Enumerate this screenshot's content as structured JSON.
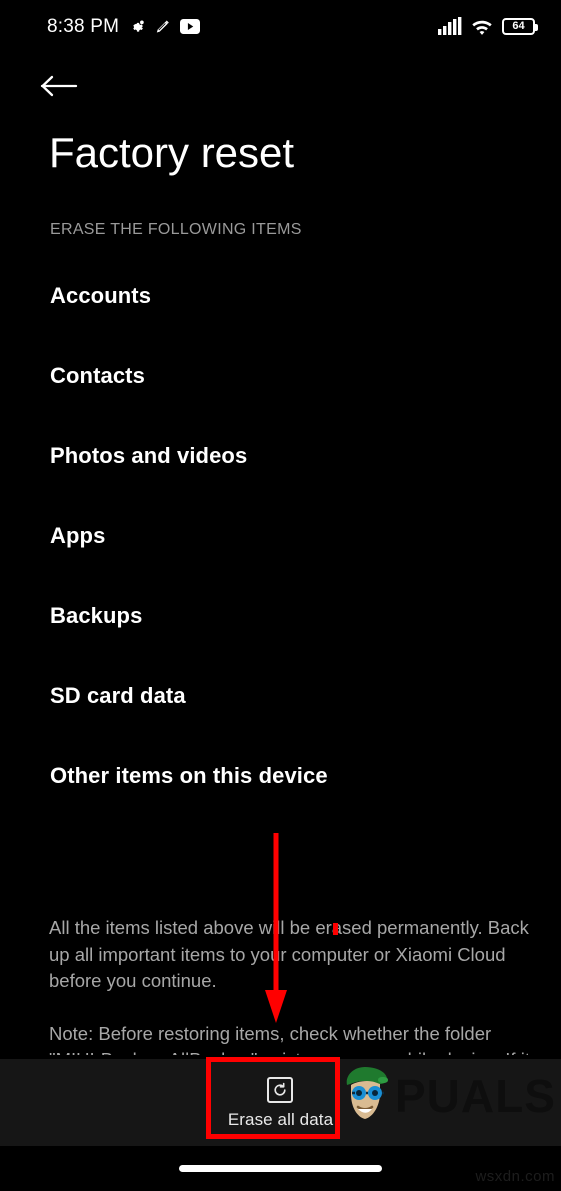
{
  "status_bar": {
    "time": "8:38 PM",
    "left_icons": [
      "gear-icon",
      "pen-icon",
      "youtube-icon"
    ],
    "right_icons": [
      "signal-icon",
      "wifi-icon"
    ],
    "battery_level": "64"
  },
  "header": {
    "back_icon": "back-arrow-icon",
    "title": "Factory reset"
  },
  "section": {
    "label": "ERASE THE FOLLOWING ITEMS"
  },
  "items": [
    {
      "label": "Accounts"
    },
    {
      "label": "Contacts"
    },
    {
      "label": "Photos and videos"
    },
    {
      "label": "Apps"
    },
    {
      "label": "Backups"
    },
    {
      "label": "SD card data"
    },
    {
      "label": "Other items on this device"
    }
  ],
  "description": {
    "paragraph1": "All the items listed above will be erased permanently. Back up all important items to your computer or Xiaomi Cloud before you continue.",
    "paragraph2": "Note: Before restoring items, check whether the folder \"MIUI-Backup-AllBackup\" exists on your mobile device. If it doesn't exist, it..."
  },
  "bottom_bar": {
    "erase_label": "Erase all data",
    "erase_icon": "reset-circle-icon"
  },
  "nav_bar": {
    "home_indicator": "home-indicator"
  },
  "annotations": {
    "arrow_color": "#ff0000",
    "highlight_color": "#ff0000"
  },
  "watermark": {
    "text": "PUALS",
    "mascot": "appuals-mascot-icon",
    "corner_url": "wsxdn.com"
  }
}
